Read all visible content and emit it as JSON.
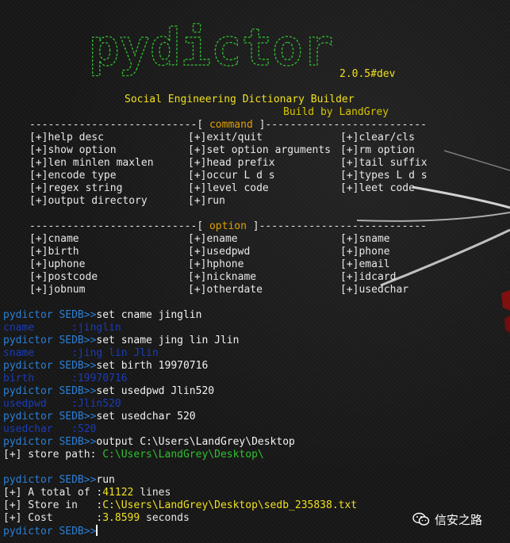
{
  "banner": {
    "logo_text": "pydictor",
    "version": "2.0.5#dev",
    "title": "Social Engineering Dictionary Builder",
    "author": "Build by LandGrey"
  },
  "command_section": {
    "left_rule": "---------------------------[ ",
    "header": "command",
    "right_rule": " ]--------------------------",
    "rows": [
      [
        "[+]help desc",
        "[+]exit/quit",
        "[+]clear/cls"
      ],
      [
        "[+]show option",
        "[+]set option arguments",
        "[+]rm option"
      ],
      [
        "[+]len minlen maxlen",
        "[+]head prefix",
        "[+]tail suffix"
      ],
      [
        "[+]encode type",
        "[+]occur L d s",
        "[+]types L d s"
      ],
      [
        "[+]regex string",
        "[+]level code",
        "[+]leet code"
      ],
      [
        "[+]output directory",
        "[+]run",
        ""
      ]
    ]
  },
  "option_section": {
    "left_rule": "---------------------------[ ",
    "header": "option",
    "right_rule": " ]---------------------------",
    "rows": [
      [
        "[+]cname",
        "[+]ename",
        "[+]sname"
      ],
      [
        "[+]birth",
        "[+]usedpwd",
        "[+]phone"
      ],
      [
        "[+]uphone",
        "[+]hphone",
        "[+]email"
      ],
      [
        "[+]postcode",
        "[+]nickname",
        "[+]idcard"
      ],
      [
        "[+]jobnum",
        "[+]otherdate",
        "[+]usedchar"
      ]
    ]
  },
  "session": {
    "prompt": "pydictor SEDB>>",
    "commands": [
      {
        "cmd": "set cname jinglin",
        "echo_key": "cname",
        "echo_sep": "      :",
        "echo_val": "jinglin"
      },
      {
        "cmd": "set sname jing lin Jlin",
        "echo_key": "sname",
        "echo_sep": "      :",
        "echo_val": "jing lin Jlin"
      },
      {
        "cmd": "set birth 19970716",
        "echo_key": "birth",
        "echo_sep": "      :",
        "echo_val": "19970716"
      },
      {
        "cmd": "set usedpwd Jlin520",
        "echo_key": "usedpwd",
        "echo_sep": "    :",
        "echo_val": "Jlin520"
      },
      {
        "cmd": "set usedchar 520",
        "echo_key": "usedchar",
        "echo_sep": "   :",
        "echo_val": "520"
      }
    ],
    "output_cmd": "output C:\\Users\\LandGrey\\Desktop",
    "store_path_label": "[+] store path: ",
    "store_path_value": "C:\\Users\\LandGrey\\Desktop\\",
    "run_cmd": "run",
    "total_label": "[+] A total of :",
    "total_value": "41122",
    "total_unit": " lines",
    "store_in_label": "[+] Store in   :",
    "store_in_value": "C:\\Users\\LandGrey\\Desktop\\sedb_235838.txt",
    "cost_label": "[+] Cost       :",
    "cost_value": "3.8599",
    "cost_unit": " seconds"
  },
  "watermark": {
    "text": "信安之路",
    "icon": "wechat-icon"
  },
  "colors": {
    "prompt": "#2a7fd6",
    "logo_green": "#2fc02f",
    "title_yellow": "#f0e020",
    "echo_blue": "#1a3cb8",
    "header_orange": "#e0a000"
  }
}
